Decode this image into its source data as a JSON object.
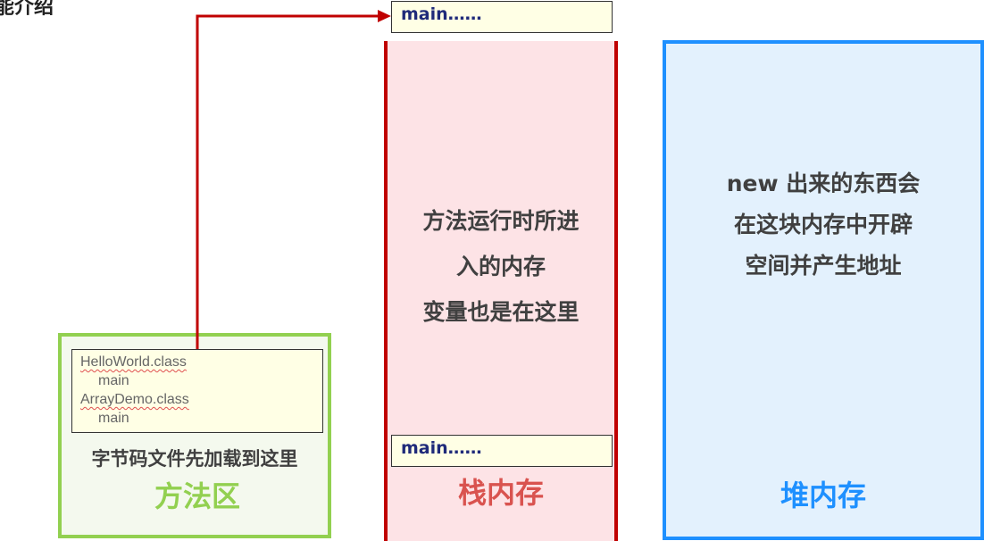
{
  "page": {
    "title_fragment": "能介绍"
  },
  "method_area": {
    "classes": [
      {
        "name": "HelloWorld.class",
        "method": "main"
      },
      {
        "name": "ArrayDemo.class",
        "method": "main"
      }
    ],
    "note": "字节码文件先加载到这里",
    "title": "方法区",
    "color": "#92d050"
  },
  "stack": {
    "top_frame": "main……",
    "bottom_frame": "main……",
    "description": [
      "方法运行时所进",
      "入的内存",
      "变量也是在这里"
    ],
    "title": "栈内存",
    "color": "#c00000"
  },
  "heap": {
    "description": [
      "new 出来的东西会",
      "在这块内存中开辟",
      "空间并产生地址"
    ],
    "title": "堆内存",
    "color": "#1e90ff"
  },
  "arrow": {
    "from": "HelloWorld.class main",
    "to": "main……",
    "color": "#c00000"
  }
}
